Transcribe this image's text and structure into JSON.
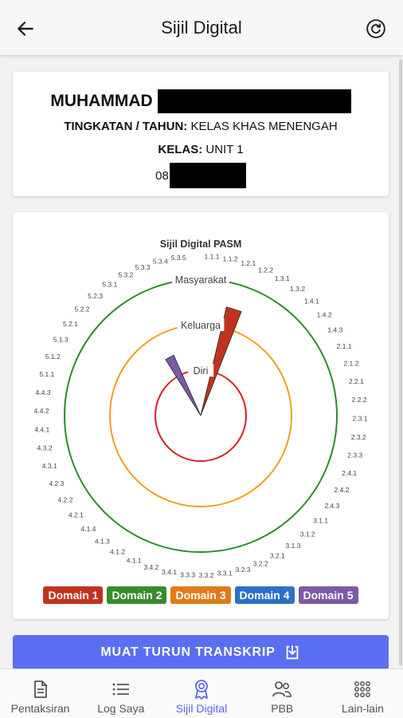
{
  "appbar": {
    "title": "Sijil Digital",
    "back_icon": "arrow-left-icon",
    "refresh_icon": "refresh-icon"
  },
  "student": {
    "name_visible": "MUHAMMAD",
    "tingkatan_label": "TINGKATAN / TAHUN:",
    "tingkatan_value": "KELAS KHAS MENENGAH",
    "kelas_label": "KELAS:",
    "kelas_value": "UNIT 1",
    "id_prefix": "08"
  },
  "chart_data": {
    "type": "radial",
    "title": "Sijil Digital PASM",
    "rings": [
      "Diri",
      "Keluarga",
      "Masyarakat"
    ],
    "ring_colors": [
      "#d32020",
      "#f0a020",
      "#2a8a2a"
    ],
    "categories": [
      "1.1.1",
      "1.1.2",
      "1.2.1",
      "1.2.2",
      "1.3.1",
      "1.3.2",
      "1.4.1",
      "1.4.2",
      "1.4.3",
      "2.1.1",
      "2.1.2",
      "2.2.1",
      "2.2.2",
      "2.3.1",
      "2.3.2",
      "2.3.3",
      "2.4.1",
      "2.4.2",
      "2.4.3",
      "3.1.1",
      "3.1.2",
      "3.1.3",
      "3.2.1",
      "3.2.2",
      "3.2.3",
      "3.3.1",
      "3.3.2",
      "3.3.3",
      "3.4.1",
      "3.4.2",
      "4.1.1",
      "4.1.2",
      "4.1.3",
      "4.1.4",
      "4.2.1",
      "4.2.2",
      "4.2.3",
      "4.3.1",
      "4.3.2",
      "4.4.1",
      "4.4.2",
      "4.4.3",
      "5.1.1",
      "5.1.2",
      "5.1.3",
      "5.2.1",
      "5.2.2",
      "5.2.3",
      "5.3.1",
      "5.3.2",
      "5.3.3",
      "5.3.4",
      "5.3.5"
    ],
    "series": [
      {
        "name": "Domain 1",
        "color": "#c0341f",
        "values": [
          {
            "category": "1.2.1",
            "level": 2
          }
        ]
      },
      {
        "name": "Domain 5",
        "color": "#7b5aa6",
        "values": [
          {
            "category": "5.3.2",
            "level": 1
          }
        ]
      }
    ],
    "legend": [
      {
        "label": "Domain 1",
        "color": "#c0341f"
      },
      {
        "label": "Domain 2",
        "color": "#3a8a2e"
      },
      {
        "label": "Domain 3",
        "color": "#e07b1c"
      },
      {
        "label": "Domain 4",
        "color": "#2f6fc6"
      },
      {
        "label": "Domain 5",
        "color": "#7b5aa6"
      }
    ]
  },
  "download_button": {
    "label": "MUAT TURUN TRANSKRIP",
    "icon": "download-icon"
  },
  "bottom_nav": [
    {
      "label": "Pentaksiran",
      "icon": "document-icon",
      "active": false
    },
    {
      "label": "Log Saya",
      "icon": "list-icon",
      "active": false
    },
    {
      "label": "Sijil Digital",
      "icon": "award-badge-icon",
      "active": true
    },
    {
      "label": "PBB",
      "icon": "people-icon",
      "active": false
    },
    {
      "label": "Lain-lain",
      "icon": "grid-icon",
      "active": false
    }
  ]
}
